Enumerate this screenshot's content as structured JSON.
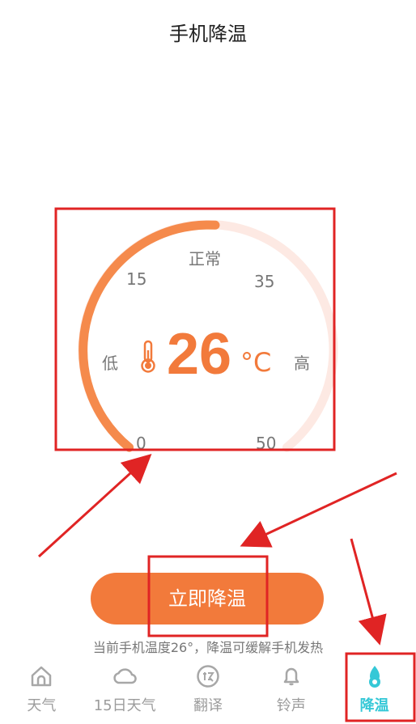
{
  "header": {
    "title": "手机降温"
  },
  "gauge": {
    "status_label": "正常",
    "low_label": "低",
    "high_label": "高",
    "ticks": [
      "15",
      "35",
      "0",
      "50"
    ],
    "temperature_value": "26",
    "temperature_unit": "°C",
    "min": 0,
    "max": 50,
    "current": 26,
    "arc_color": "#f58a4c",
    "track_color": "#fde9e3"
  },
  "action": {
    "button_label": "立即降温",
    "note": "当前手机温度26°，降温可缓解手机发热"
  },
  "tabs": [
    {
      "label": "天气",
      "icon": "home-icon"
    },
    {
      "label": "15日天气",
      "icon": "cloud-icon"
    },
    {
      "label": "翻译",
      "icon": "translate-icon"
    },
    {
      "label": "铃声",
      "icon": "bell-icon"
    },
    {
      "label": "降温",
      "icon": "cool-drop-icon",
      "active": true
    }
  ],
  "colors": {
    "accent": "#f27a3b",
    "active_tab": "#35c8d7",
    "annotation_red": "#e02424"
  }
}
